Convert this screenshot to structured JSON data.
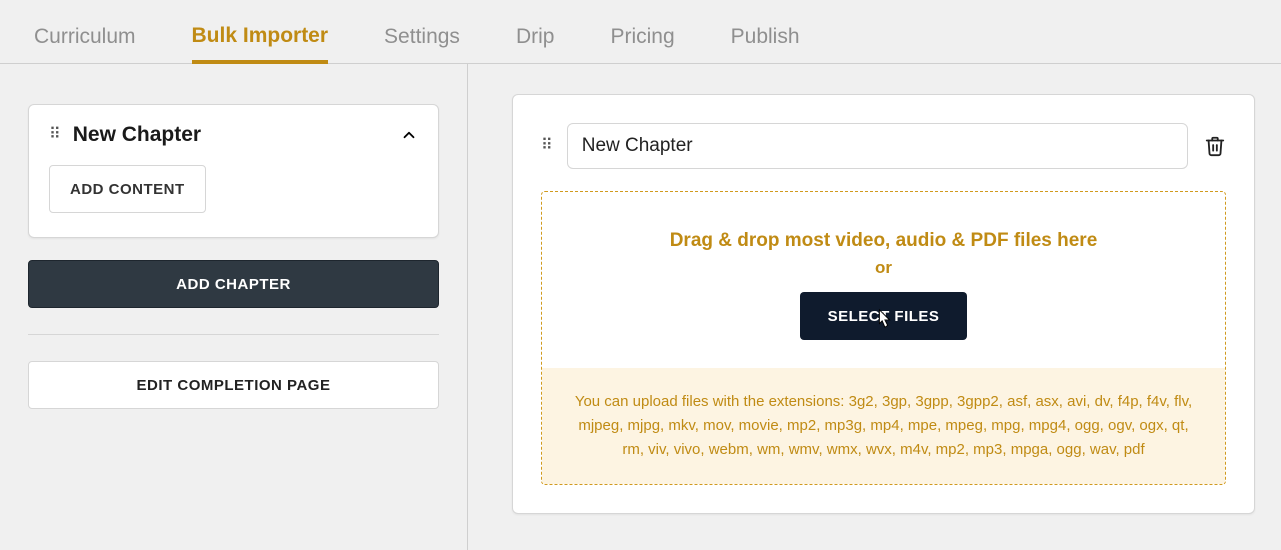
{
  "tabs": {
    "items": [
      {
        "label": "Curriculum",
        "active": false
      },
      {
        "label": "Bulk Importer",
        "active": true
      },
      {
        "label": "Settings",
        "active": false
      },
      {
        "label": "Drip",
        "active": false
      },
      {
        "label": "Pricing",
        "active": false
      },
      {
        "label": "Publish",
        "active": false
      }
    ]
  },
  "sidebar": {
    "chapter_title": "New Chapter",
    "add_content_label": "ADD CONTENT",
    "add_chapter_label": "ADD CHAPTER",
    "edit_completion_label": "EDIT COMPLETION PAGE"
  },
  "main": {
    "title_value": "New Chapter",
    "dropzone": {
      "line1": "Drag & drop most video, audio & PDF files here",
      "or": "or",
      "select_files_label": "SELECT FILES",
      "extensions_text": "You can upload files with the extensions: 3g2, 3gp, 3gpp, 3gpp2, asf, asx, avi, dv, f4p, f4v, flv, mjpeg, mjpg, mkv, mov, movie, mp2, mp3g, mp4, mpe, mpeg, mpg, mpg4, ogg, ogv, ogx, qt, rm, viv, vivo, webm, wm, wmv, wmx, wvx, m4v, mp2, mp3, mpga, ogg, wav, pdf"
    }
  }
}
